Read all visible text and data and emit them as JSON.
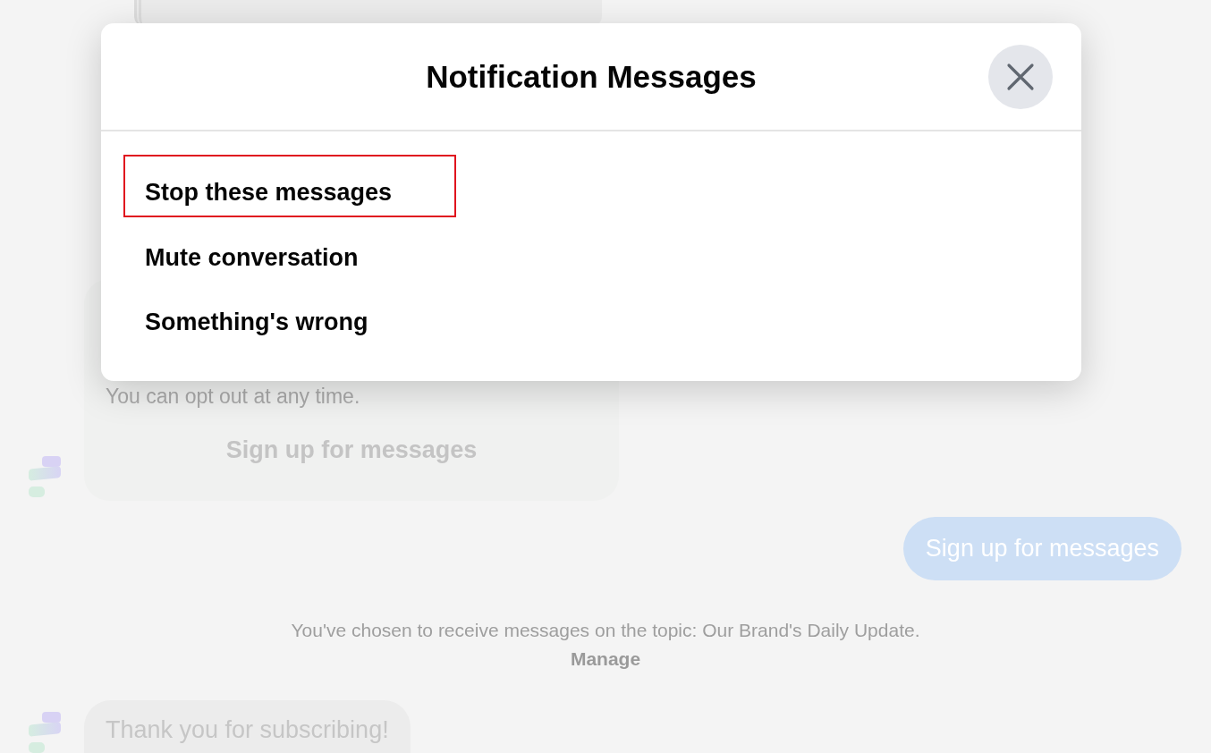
{
  "conversation": {
    "opt_in_card": {
      "text": "You can opt out at any time.",
      "button": "Sign up for messages"
    },
    "user_reply": "Sign up for messages",
    "notice": {
      "text": "You've chosen to receive messages on the topic: Our Brand's Daily Update.",
      "link": "Manage"
    },
    "bot_message": "Thank you for subscribing!"
  },
  "dialog": {
    "title": "Notification Messages",
    "items": [
      {
        "label": "Stop these messages",
        "highlighted": true
      },
      {
        "label": "Mute conversation",
        "highlighted": false
      },
      {
        "label": "Something's wrong",
        "highlighted": false
      }
    ]
  }
}
